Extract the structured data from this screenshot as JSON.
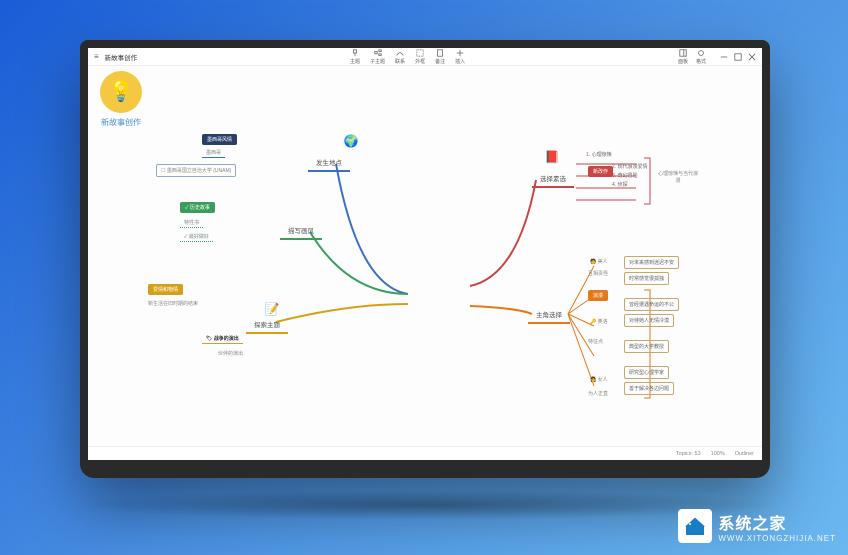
{
  "window": {
    "title": "新故事创作"
  },
  "toolbar": {
    "items": [
      {
        "label": "主题",
        "icon": "theme"
      },
      {
        "label": "子主题",
        "icon": "sub"
      },
      {
        "label": "联系",
        "icon": "link"
      },
      {
        "label": "外框",
        "icon": "frame"
      },
      {
        "label": "备注",
        "icon": "note"
      },
      {
        "label": "插入",
        "icon": "insert"
      }
    ],
    "right": [
      {
        "label": "面板",
        "icon": "panel"
      },
      {
        "label": "格式",
        "icon": "format"
      }
    ]
  },
  "mindmap": {
    "center": "新故事创作",
    "branches": {
      "location": {
        "title": "发生地点",
        "tag": "墨西哥风情",
        "sub": "墨西哥",
        "detail": "墨西哥国立自治大学 (UNAM)"
      },
      "style": {
        "title": "描写画风",
        "tag": "历史故事",
        "subs": [
          "特性书",
          "最好做好"
        ]
      },
      "theme": {
        "title": "探索主题",
        "tag": "爱情和物情",
        "detail": "新生活在旧时期的结束",
        "bold": "战争的演出",
        "sub": "伙伴的演出"
      },
      "book": {
        "title": "选择素选",
        "tag": "新改作",
        "items": [
          {
            "n": "1",
            "t": "心理惊悚"
          },
          {
            "n": "2",
            "t": "现代浪漫爱情"
          },
          {
            "n": "3",
            "t": "奇幻冒险"
          },
          {
            "n": "4",
            "t": "侦探"
          }
        ],
        "right": "心理惊悚与当代浪漫"
      },
      "character": {
        "title": "主角选择",
        "cats": [
          {
            "icon": "🧑",
            "label": "美人",
            "t": "互相责怪"
          },
          {
            "label": "浪漫",
            "tag": true
          },
          {
            "icon": "🔑",
            "label": "奥洛"
          },
          {
            "label": "特征点"
          },
          {
            "icon": "👩",
            "label": "女人",
            "t": "为人正直"
          }
        ],
        "details": [
          "对未来感到迷迟不安",
          "时常感觉很孤独",
          "曾经遭遇命运的不公",
          "对待她人无情冷漠",
          "典型的大学教授",
          "研究型心理学家",
          "善于解决各边问题"
        ]
      }
    }
  },
  "statusbar": {
    "topics": "Topics: 53",
    "zoom": "100%",
    "outliner": "Outliner"
  },
  "watermark": {
    "name": "系统之家",
    "url": "WWW.XITONGZHIJIA.NET"
  }
}
